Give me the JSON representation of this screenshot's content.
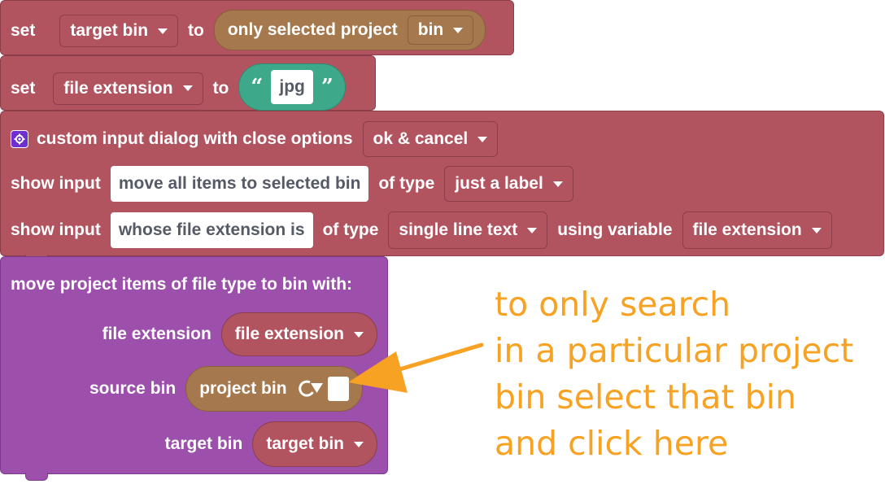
{
  "block1": {
    "set": "set",
    "variable": "target bin",
    "to": "to",
    "value_prefix": "only selected  project",
    "value_dropdown": "bin"
  },
  "block2": {
    "set": "set",
    "variable": "file extension",
    "to": "to",
    "open_quote": "“",
    "value": "jpg",
    "close_quote": "”"
  },
  "block3": {
    "title": "custom input dialog with close options",
    "close_option": "ok & cancel",
    "row1": {
      "label": "show input",
      "text": "move all items to selected bin",
      "of_type": "of type",
      "type": "just a label"
    },
    "row2": {
      "label": "show input",
      "text": "whose file extension is",
      "of_type": "of type",
      "type": "single line text",
      "using": "using variable",
      "variable": "file extension"
    }
  },
  "block4": {
    "title": "move project items of file type to bin  with:",
    "file_extension_label": "file extension",
    "file_extension_value": "file extension",
    "source_bin_label": "source bin",
    "source_bin_value": "project bin",
    "target_bin_label": "target bin",
    "target_bin_value": "target bin"
  },
  "annotation": {
    "lines": [
      "to only search",
      "in a particular project",
      "bin select that bin",
      "and click here"
    ],
    "color": "#f7a223"
  },
  "colors": {
    "red_block": "#b15460",
    "purple_block": "#9c4fab",
    "brown_value": "#a6784e",
    "teal_text": "#3da88a",
    "gear": "#6f2fd0"
  }
}
